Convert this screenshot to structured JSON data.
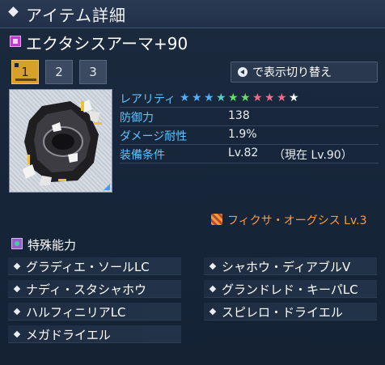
{
  "window": {
    "title": "アイテム詳細"
  },
  "item": {
    "name": "エクタシスアーマ+90"
  },
  "tabs": [
    {
      "label": "1",
      "active": true
    },
    {
      "label": "2",
      "active": false
    },
    {
      "label": "3",
      "active": false
    }
  ],
  "toggle_button": {
    "label": "で表示切り替え"
  },
  "stats": {
    "rarity": {
      "label": "レアリティ",
      "star_colors": [
        "#4fb0ff",
        "#4fb0ff",
        "#4fb0ff",
        "#4fd0c0",
        "#5fe06a",
        "#5fe06a",
        "#f06a8a",
        "#f06a8a",
        "#f06a8a",
        "#ffffff"
      ],
      "count": 10
    },
    "defense": {
      "label": "防御力",
      "value": "138"
    },
    "damage_resist": {
      "label": "ダメージ耐性",
      "value": "1.9%"
    },
    "requirement": {
      "label": "装備条件",
      "value": "Lv.82",
      "current": "（現在 Lv.90）"
    }
  },
  "unit": {
    "name": "フィクサ・オーグシス Lv.3"
  },
  "abilities": {
    "title": "特殊能力",
    "items": [
      "グラディエ・ソールLC",
      "シャホウ・ディアブルⅤ",
      "ナディ・スタシャホウ",
      "グランドレド・キーパLC",
      "ハルフィニリアLC",
      "スピレロ・ドライエル",
      "メガドライエル"
    ]
  },
  "colors": {
    "accent": "#d7a02a",
    "label_blue": "#5fc3ff",
    "unit_orange": "#ff9a3c"
  }
}
